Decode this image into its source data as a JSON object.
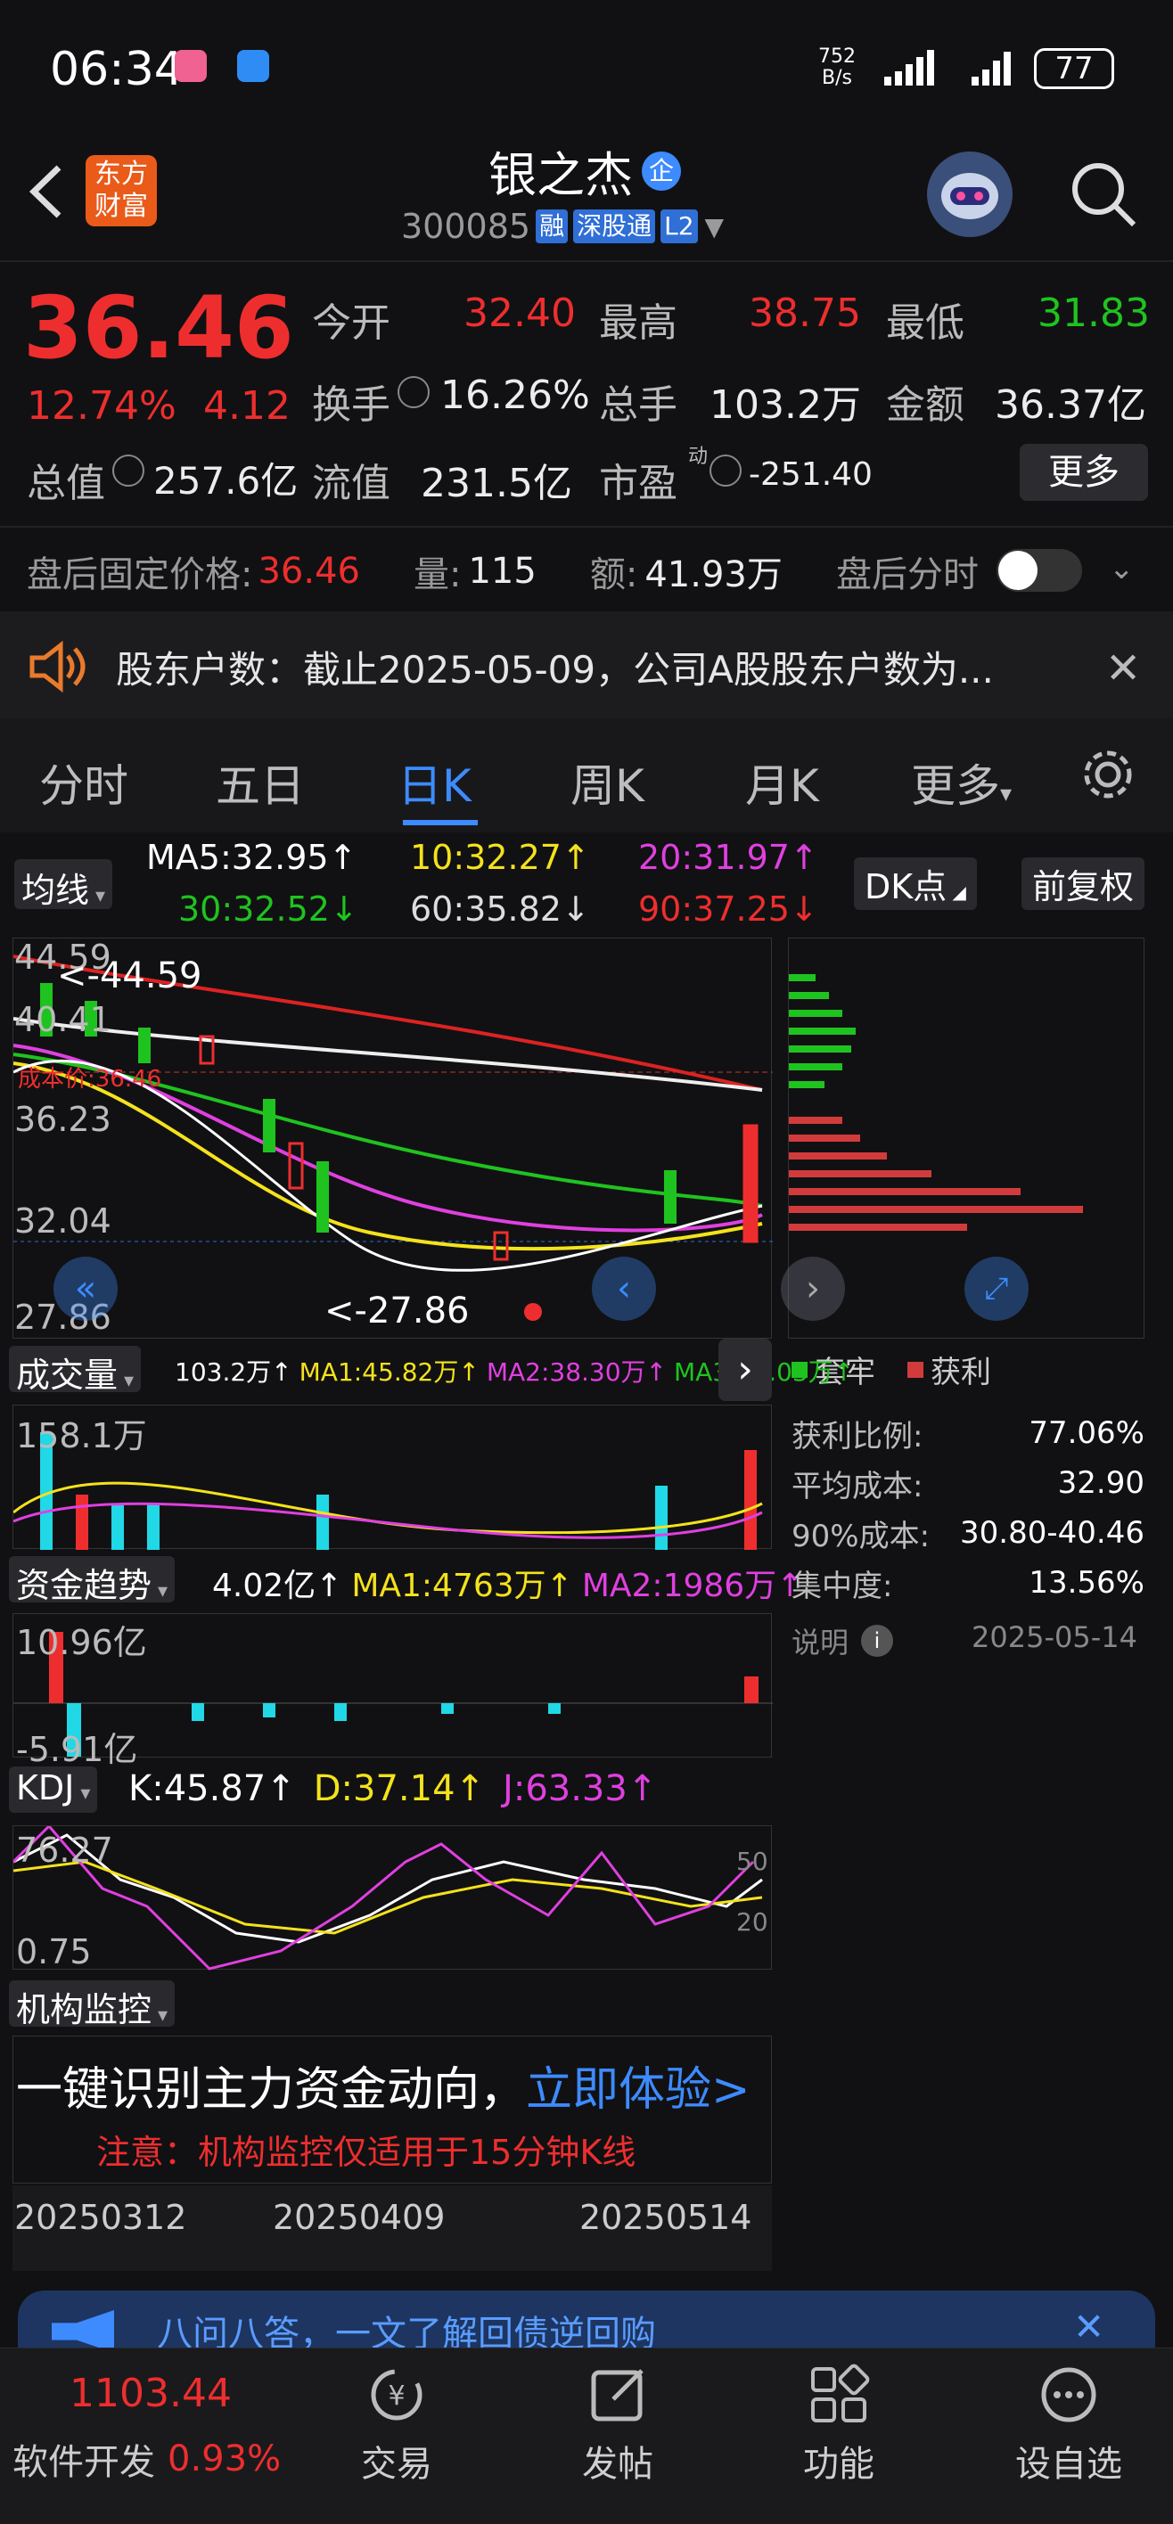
{
  "status_bar": {
    "time": "06:34",
    "net_speed_top": "752",
    "net_speed_bottom": "B/s",
    "battery": "77"
  },
  "header": {
    "title": "银之杰",
    "title_badge": "企",
    "code": "300085",
    "tags": [
      "融",
      "深股通",
      "L2"
    ]
  },
  "quote": {
    "price": "36.46",
    "change_pct": "12.74%",
    "change": "4.12",
    "fields": [
      {
        "label": "今开",
        "value": "32.40",
        "color": "red"
      },
      {
        "label": "最高",
        "value": "38.75",
        "color": "red"
      },
      {
        "label": "最低",
        "value": "31.83",
        "color": "green"
      },
      {
        "label": "换手",
        "value": "16.26%",
        "color": "white"
      },
      {
        "label": "总手",
        "value": "103.2万",
        "color": "white"
      },
      {
        "label": "金额",
        "value": "36.37亿",
        "color": "white"
      },
      {
        "label": "总值",
        "value": "257.6亿",
        "color": "white"
      },
      {
        "label": "流值",
        "value": "231.5亿",
        "color": "white"
      },
      {
        "label": "市盈",
        "value": "-251.40",
        "color": "white"
      }
    ],
    "more_label": "更多",
    "pe_sup": "动"
  },
  "after_hours": {
    "label": "盘后固定价格:",
    "price": "36.46",
    "vol_label": "量:",
    "vol": "115",
    "amt_label": "额:",
    "amt": "41.93万",
    "toggle_label": "盘后分时"
  },
  "notice": {
    "text": "股东户数：截止2025-05-09，公司A股股东户数为..."
  },
  "tabs": [
    "分时",
    "五日",
    "日K",
    "周K",
    "月K",
    "更多"
  ],
  "active_tab": 2,
  "ma": {
    "selector": "均线",
    "ma5": "MA5:32.95↑",
    "ma10": "10:32.27↑",
    "ma20": "20:31.97↑",
    "ma30": "30:32.52↓",
    "ma60": "60:35.82↓",
    "ma90": "90:37.25↓",
    "dk_label": "DK点",
    "fq_label": "前复权"
  },
  "kline": {
    "y_labels": [
      "44.59",
      "40.41",
      "36.23",
      "32.04",
      "27.86"
    ],
    "high_mark": "<-44.59",
    "low_mark": "<-27.86",
    "cost_label": "成本价:36.46"
  },
  "volume": {
    "selector": "成交量",
    "vol": "103.2万↑",
    "ma1": "MA1:45.82万↑",
    "ma2": "MA2:38.30万↑",
    "ma3": "MA3:32.03万↑",
    "max_label": "158.1万"
  },
  "fund": {
    "selector": "资金趋势",
    "val": "4.02亿↑",
    "ma1": "MA1:4763万↑",
    "ma2": "MA2:1986万↑",
    "top": "10.96亿",
    "bottom": "-5.91亿"
  },
  "kdj": {
    "selector": "KDJ",
    "k": "K:45.87↑",
    "d": "D:37.14↑",
    "j": "J:63.33↑",
    "top": "76.27",
    "bottom": "0.75",
    "r50": "50",
    "r20": "20"
  },
  "inst": {
    "selector": "机构监控",
    "main": "一键识别主力资金动向，",
    "link": "立即体验>",
    "note": "注意：机构监控仅适用于15分钟K线"
  },
  "dates": [
    "20250312",
    "20250409",
    "20250514"
  ],
  "chip": {
    "legend_a": "套牢",
    "legend_b": "获利",
    "rows": [
      {
        "k": "获利比例:",
        "v": "77.06%"
      },
      {
        "k": "平均成本:",
        "v": "32.90"
      },
      {
        "k": "90%成本:",
        "v": "30.80-40.46"
      },
      {
        "k": "集中度:",
        "v": "13.56%"
      }
    ],
    "explain": "说明",
    "date": "2025-05-14"
  },
  "banner": {
    "text": "八问八答，一文了解回债逆回购"
  },
  "bottom_nav": {
    "index_value": "1103.44",
    "index_name": "软件开发",
    "index_pct": "0.93%",
    "items": [
      "交易",
      "发帖",
      "功能",
      "设自选"
    ]
  },
  "colors": {
    "up": "#ee2e2e",
    "down": "#1fc31f",
    "accent": "#3d8bff",
    "bg": "#111113"
  }
}
